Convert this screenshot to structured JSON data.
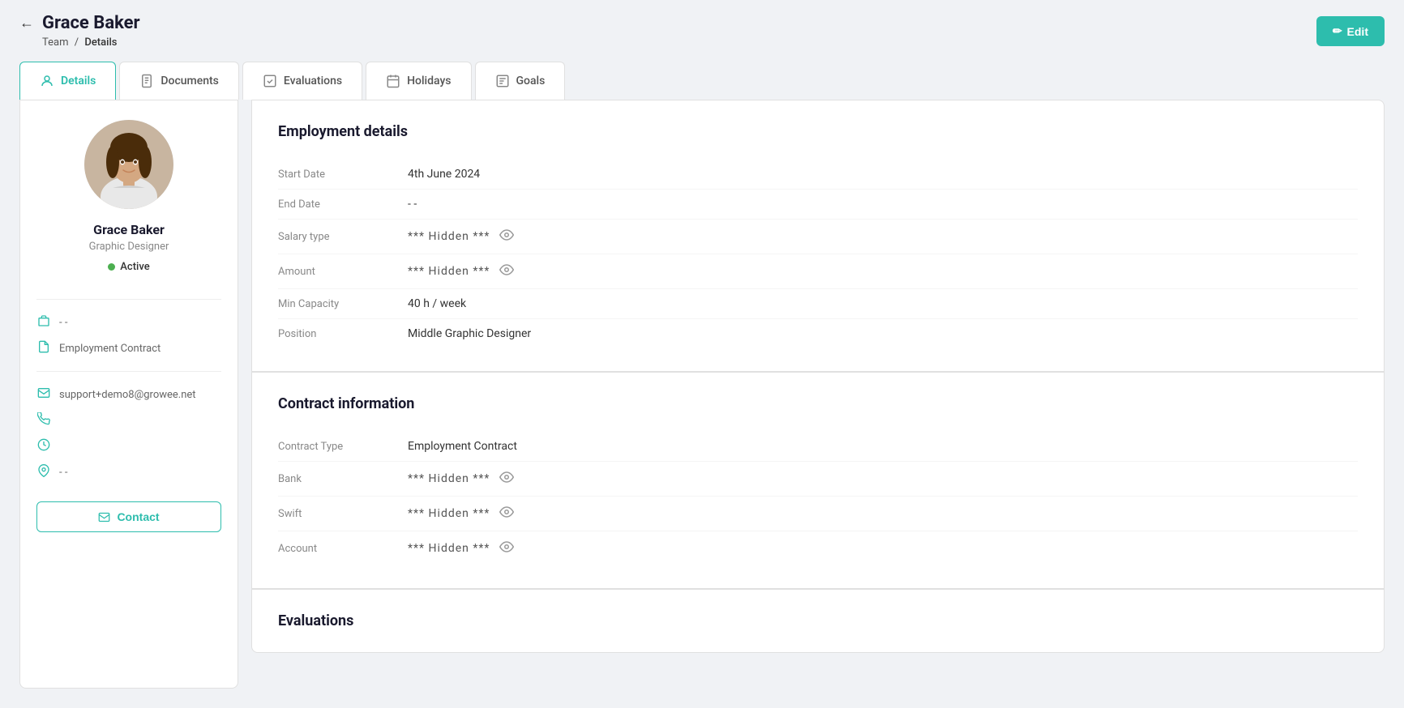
{
  "header": {
    "back_label": "←",
    "title": "Grace Baker",
    "breadcrumb_team": "Team",
    "breadcrumb_separator": "/",
    "breadcrumb_current": "Details",
    "edit_button_label": "Edit",
    "edit_icon": "✏"
  },
  "tabs": [
    {
      "id": "details",
      "label": "Details",
      "active": true
    },
    {
      "id": "documents",
      "label": "Documents",
      "active": false
    },
    {
      "id": "evaluations",
      "label": "Evaluations",
      "active": false
    },
    {
      "id": "holidays",
      "label": "Holidays",
      "active": false
    },
    {
      "id": "goals",
      "label": "Goals",
      "active": false
    }
  ],
  "sidebar": {
    "user_name": "Grace Baker",
    "user_title": "Graphic Designer",
    "status_label": "Active",
    "info_rows": [
      {
        "icon": "👜",
        "value": "- -"
      },
      {
        "icon": "📄",
        "value": "Employment Contract"
      }
    ],
    "contact_info": [
      {
        "icon": "✉",
        "value": "support+demo8@growee.net"
      },
      {
        "icon": "📞",
        "value": ""
      },
      {
        "icon": "🕐",
        "value": ""
      },
      {
        "icon": "📍",
        "value": "- -"
      }
    ],
    "contact_button_label": "Contact"
  },
  "employment": {
    "section_title": "Employment details",
    "fields": [
      {
        "label": "Start Date",
        "value": "4th June 2024",
        "hidden": false
      },
      {
        "label": "End Date",
        "value": "- -",
        "hidden": false
      },
      {
        "label": "Salary type",
        "value": "*** Hidden ***",
        "hidden": true
      },
      {
        "label": "Amount",
        "value": "*** Hidden ***",
        "hidden": true
      },
      {
        "label": "Min Capacity",
        "value": "40 h / week",
        "hidden": false
      },
      {
        "label": "Position",
        "value": "Middle Graphic Designer",
        "hidden": false
      }
    ]
  },
  "contract": {
    "section_title": "Contract information",
    "fields": [
      {
        "label": "Contract Type",
        "value": "Employment Contract",
        "hidden": false
      },
      {
        "label": "Bank",
        "value": "*** Hidden ***",
        "hidden": true
      },
      {
        "label": "Swift",
        "value": "*** Hidden ***",
        "hidden": true
      },
      {
        "label": "Account",
        "value": "*** Hidden ***",
        "hidden": true
      }
    ]
  },
  "evaluations": {
    "section_title": "Evaluations"
  },
  "colors": {
    "accent": "#2dbdad",
    "active_green": "#4caf50"
  }
}
